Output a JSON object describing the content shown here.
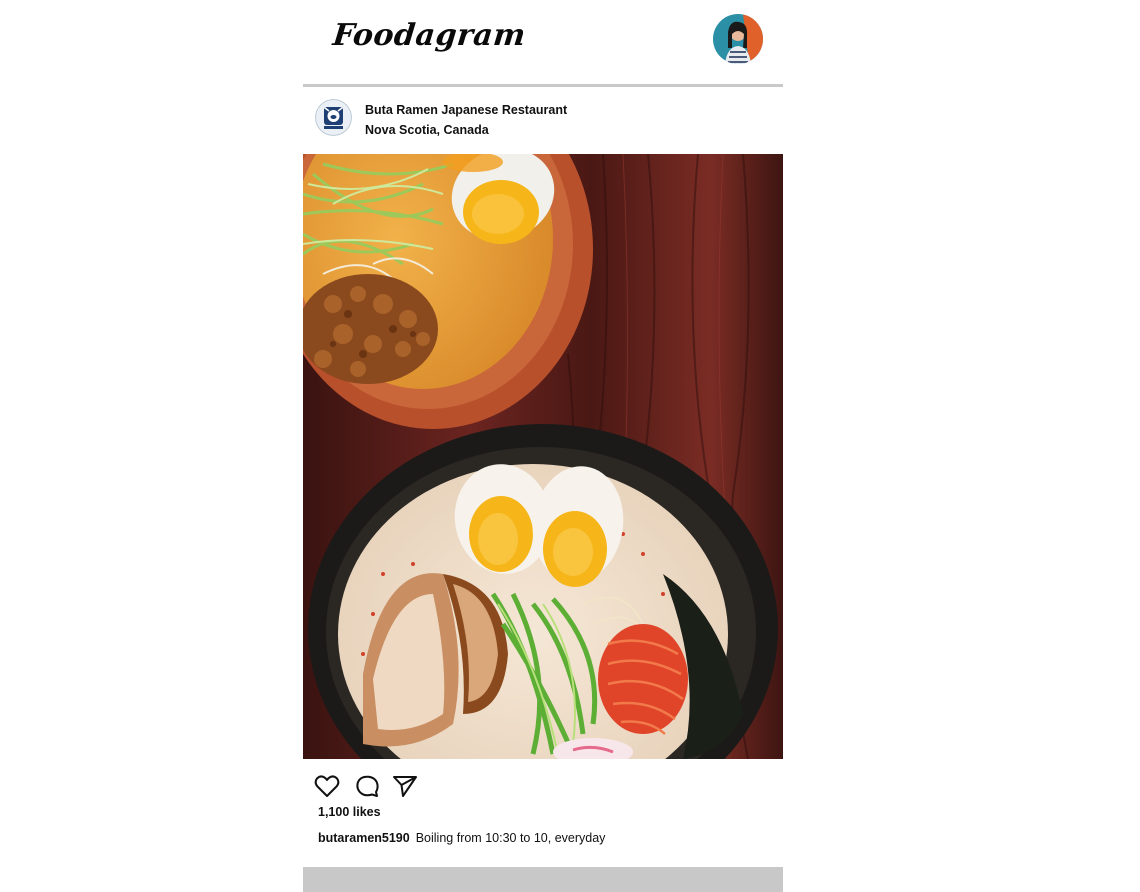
{
  "app": {
    "logo_text": "Foodagram"
  },
  "post": {
    "account_name": "Buta Ramen Japanese Restaurant",
    "location": "Nova Scotia, Canada",
    "likes_text": "1,100 likes",
    "caption_user": "butaramen5190",
    "caption_text": "Boiling from 10:30 to 10, everyday"
  },
  "icons": {
    "like": "heart-icon",
    "comment": "comment-icon",
    "share": "send-icon"
  },
  "colors": {
    "rule": "#c9c9c9",
    "next_post_placeholder": "#c8c8c8",
    "wood": "#5a1e1a"
  }
}
